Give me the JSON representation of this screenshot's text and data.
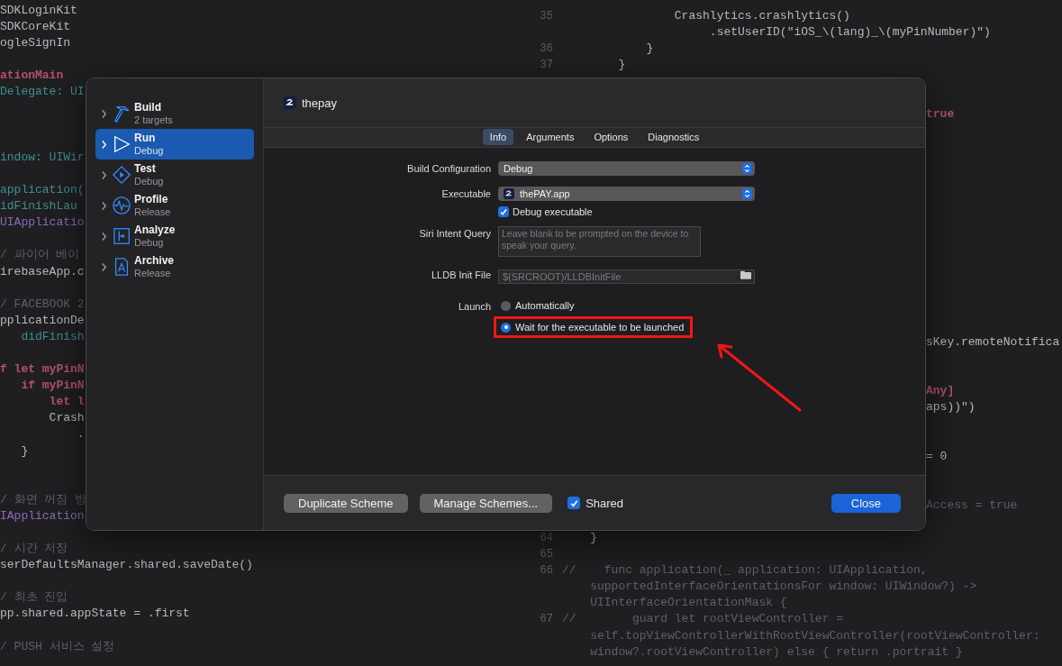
{
  "editor": {
    "left_lines": [
      {
        "kind": "plain",
        "code": "SDKLoginKit"
      },
      {
        "kind": "plain",
        "code": "SDKCoreKit"
      },
      {
        "kind": "plain",
        "code": "ogleSignIn"
      },
      {
        "kind": "blank"
      },
      {
        "kind": "keyword",
        "code": "ationMain"
      },
      {
        "kind": "type",
        "code": "Delegate: UI"
      },
      {
        "kind": "blank"
      },
      {
        "kind": "blank"
      },
      {
        "kind": "blank"
      },
      {
        "kind": "type",
        "code": "indow: UIWir"
      },
      {
        "kind": "blank"
      },
      {
        "kind": "type",
        "code": "application("
      },
      {
        "kind": "type",
        "code": "idFinishLau"
      },
      {
        "kind": "class",
        "code": "UIApplicatio"
      },
      {
        "kind": "blank"
      },
      {
        "kind": "comment",
        "code": "/ 파이어 베이"
      },
      {
        "kind": "plain",
        "code": "irebaseApp.c"
      },
      {
        "kind": "blank"
      },
      {
        "kind": "comment",
        "code": "/ FACEBOOK 2"
      },
      {
        "kind": "plain",
        "code": "pplicationDe"
      },
      {
        "kind": "type",
        "code": "   didFinish"
      },
      {
        "kind": "blank"
      },
      {
        "kind": "keyword",
        "code": "f let myPinN"
      },
      {
        "kind": "keyword",
        "code": "   if myPinN"
      },
      {
        "kind": "keyword",
        "code": "       let l"
      },
      {
        "kind": "plain",
        "code": "       Crash"
      },
      {
        "kind": "plain",
        "code": "           ."
      },
      {
        "kind": "plain",
        "code": "   }"
      },
      {
        "kind": "blank"
      },
      {
        "kind": "blank"
      },
      {
        "kind": "comment",
        "code": "/ 화면 꺼짐 방"
      },
      {
        "kind": "class",
        "code": "IApplication"
      },
      {
        "kind": "blank"
      },
      {
        "kind": "comment",
        "code": "/ 시간 저장"
      },
      {
        "kind": "plain",
        "code": "serDefaultsManager.shared.saveDate()"
      },
      {
        "kind": "blank"
      },
      {
        "kind": "comment",
        "code": "/ 최초 진입"
      },
      {
        "kind": "plain",
        "code": "pp.shared.appState = .first"
      },
      {
        "kind": "blank"
      },
      {
        "kind": "comment",
        "code": "/ PUSH 서비스 설정"
      }
    ],
    "right_lines": [
      {
        "kind": "plain",
        "number": "35",
        "code": "                Crashlytics.crashlytics()"
      },
      {
        "kind": "plain",
        "code": "                     .setUserID(\"iOS_\\(lang)_\\(myPinNumber)\")"
      },
      {
        "kind": "plain",
        "number": "36",
        "code": "            }"
      },
      {
        "kind": "plain",
        "number": "37",
        "code": "        }"
      },
      {
        "kind": "blank"
      },
      {
        "kind": "blank"
      },
      {
        "kind": "edge-keyword",
        "code": "true"
      },
      {
        "kind": "blank"
      },
      {
        "kind": "blank"
      },
      {
        "kind": "blank"
      },
      {
        "kind": "blank"
      },
      {
        "kind": "blank"
      },
      {
        "kind": "blank"
      },
      {
        "kind": "blank"
      },
      {
        "kind": "blank"
      },
      {
        "kind": "blank"
      },
      {
        "kind": "blank"
      },
      {
        "kind": "blank"
      },
      {
        "kind": "blank"
      },
      {
        "kind": "blank"
      },
      {
        "kind": "edge",
        "code": "sKey.remoteNotifica"
      },
      {
        "kind": "blank"
      },
      {
        "kind": "blank"
      },
      {
        "kind": "edge-keyword",
        "code": "Any]"
      },
      {
        "kind": "edge",
        "code": "aps))\")"
      },
      {
        "kind": "blank"
      },
      {
        "kind": "blank"
      },
      {
        "kind": "edge",
        "code": "= 0"
      },
      {
        "kind": "blank"
      },
      {
        "kind": "blank"
      },
      {
        "kind": "edge-comment",
        "code": "Access = true"
      },
      {
        "kind": "blank"
      },
      {
        "kind": "plain",
        "number": "64",
        "code": "    }"
      },
      {
        "kind": "plain",
        "number": "65"
      },
      {
        "kind": "comment",
        "number": "66",
        "code": "//    func application(_ application: UIApplication,"
      },
      {
        "kind": "comment",
        "code": "    supportedInterfaceOrientationsFor window: UIWindow?) ->"
      },
      {
        "kind": "comment",
        "code": "    UIInterfaceOrientationMask {"
      },
      {
        "kind": "comment",
        "number": "67",
        "code": "//        guard let rootViewController ="
      },
      {
        "kind": "comment",
        "code": "    self.topViewControllerWithRootViewController(rootViewController:"
      },
      {
        "kind": "comment",
        "code": "    window?.rootViewController) else { return .portrait }"
      }
    ]
  },
  "dialog": {
    "sidebar": [
      {
        "kind": "build",
        "title": "Build",
        "subtitle": "2 targets",
        "selected": false
      },
      {
        "kind": "run",
        "title": "Run",
        "subtitle": "Debug",
        "selected": true
      },
      {
        "kind": "test",
        "title": "Test",
        "subtitle": "Debug",
        "selected": false
      },
      {
        "kind": "profile",
        "title": "Profile",
        "subtitle": "Release",
        "selected": false
      },
      {
        "kind": "analyze",
        "title": "Analyze",
        "subtitle": "Debug",
        "selected": false
      },
      {
        "kind": "archive",
        "title": "Archive",
        "subtitle": "Release",
        "selected": false
      }
    ],
    "scheme": "thepay",
    "tabs": [
      {
        "label": "Info",
        "selected": true
      },
      {
        "label": "Arguments",
        "selected": false
      },
      {
        "label": "Options",
        "selected": false
      },
      {
        "label": "Diagnostics",
        "selected": false
      }
    ],
    "form": {
      "build_configuration": {
        "label": "Build Configuration",
        "value": "Debug"
      },
      "executable": {
        "label": "Executable",
        "value": "thePAY.app"
      },
      "debug_executable": {
        "label": "Debug executable",
        "checked": true
      },
      "siri_intent_query": {
        "label": "Siri Intent Query",
        "placeholder": "Leave blank to be prompted on the device to speak your query."
      },
      "lldb_init_file": {
        "label": "LLDB Init File",
        "placeholder": "$(SRCROOT)/LLDBInitFile"
      },
      "launch": {
        "label": "Launch",
        "options": [
          {
            "label": "Automatically",
            "selected": false,
            "highlighted": false
          },
          {
            "label": "Wait for the executable to be launched",
            "selected": true,
            "highlighted": true
          }
        ]
      }
    },
    "footer": {
      "buttons": [
        "Duplicate Scheme",
        "Manage Schemes..."
      ],
      "shared": {
        "label": "Shared",
        "checked": true
      },
      "close": "Close"
    }
  }
}
